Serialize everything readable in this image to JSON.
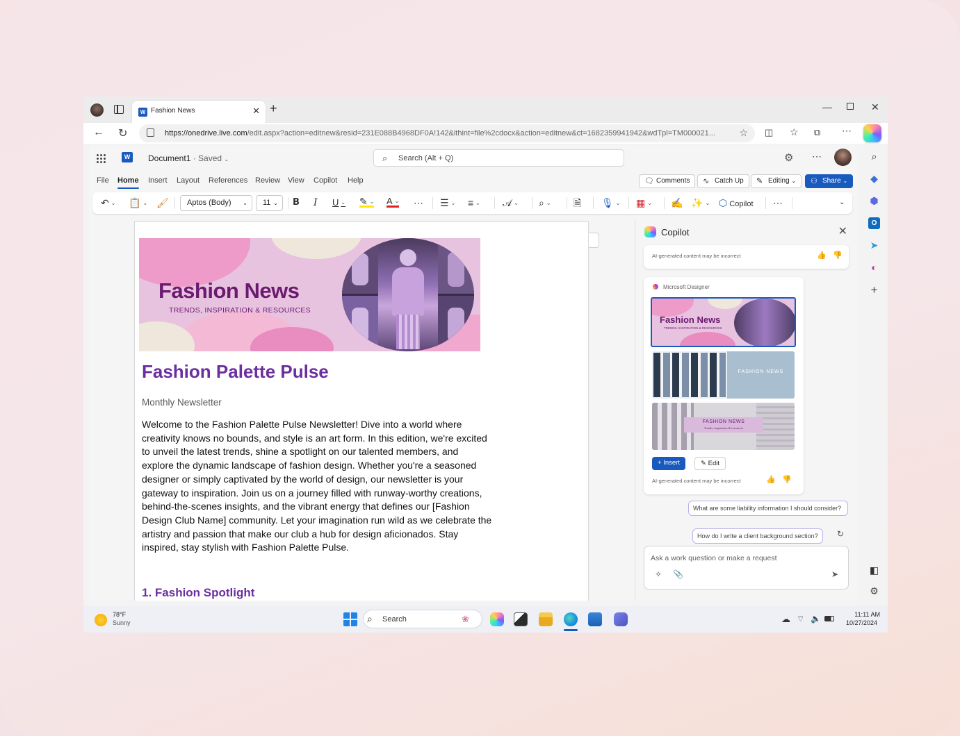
{
  "browser": {
    "tab_title": "Fashion News",
    "url_host": "https://onedrive.live.com",
    "url_path": "/edit.aspx?action=editnew&resid=231E088B4968DF0A!142&ithint=file%2cdocx&action=editnew&ct=1682359941942&wdTpl=TM000021..."
  },
  "word": {
    "doc_name": "Document1",
    "doc_status": "· Saved",
    "search_placeholder": "Search (Alt + Q)",
    "menu": [
      "File",
      "Home",
      "Insert",
      "Layout",
      "References",
      "Review",
      "View",
      "Copilot",
      "Help"
    ],
    "active_menu": "Home",
    "buttons": {
      "comments": "Comments",
      "catchup": "Catch Up",
      "editing": "Editing",
      "share": "Share"
    },
    "ribbon": {
      "font": "Aptos (Body)",
      "size": "11",
      "copilot": "Copilot"
    }
  },
  "document": {
    "banner_title": "Fashion News",
    "banner_subtitle": "TRENDS, INSPIRATION & RESOURCES",
    "title": "Fashion Palette Pulse",
    "subtitle": "Monthly Newsletter",
    "body": "Welcome to the Fashion Palette Pulse Newsletter! Dive into a world where creativity knows no bounds, and style is an art form. In this edition, we're excited to unveil the latest trends, shine a spotlight on our talented members, and explore the dynamic landscape of fashion design. Whether you're a seasoned designer or simply captivated by the world of design, our newsletter is your gateway to inspiration. Join us on a journey filled with runway-worthy creations, behind-the-scenes insights, and the vibrant energy that defines our [Fashion Design Club Name] community. Let your imagination run wild as we celebrate the artistry and passion that make our club a hub for design aficionados. Stay inspired, stay stylish with Fashion Palette Pulse.",
    "heading2": "1. Fashion Spotlight"
  },
  "copilot": {
    "title": "Copilot",
    "disclaimer": "AI-generated content may be incorrect",
    "designer_label": "Microsoft Designer",
    "option1_title": "Fashion News",
    "option1_sub": "TRENDS, INSPIRATION & RESOURCES",
    "option2_title": "FASHION NEWS",
    "option3_title": "FASHION NEWS",
    "option3_sub": "Trends, inspiration & resources",
    "insert_label": "Insert",
    "edit_label": "Edit",
    "suggestion1": "What are some liability information I should consider?",
    "suggestion2": "How do I write a client background section?",
    "ask_placeholder": "Ask a work question or make a request"
  },
  "taskbar": {
    "temp": "78°F",
    "weather": "Sunny",
    "search": "Search",
    "time": "11:11 AM",
    "date": "10/27/2024"
  },
  "colors": {
    "accent": "#185abd",
    "heading": "#6b2fa0",
    "banner_text": "#6b1a6f"
  }
}
